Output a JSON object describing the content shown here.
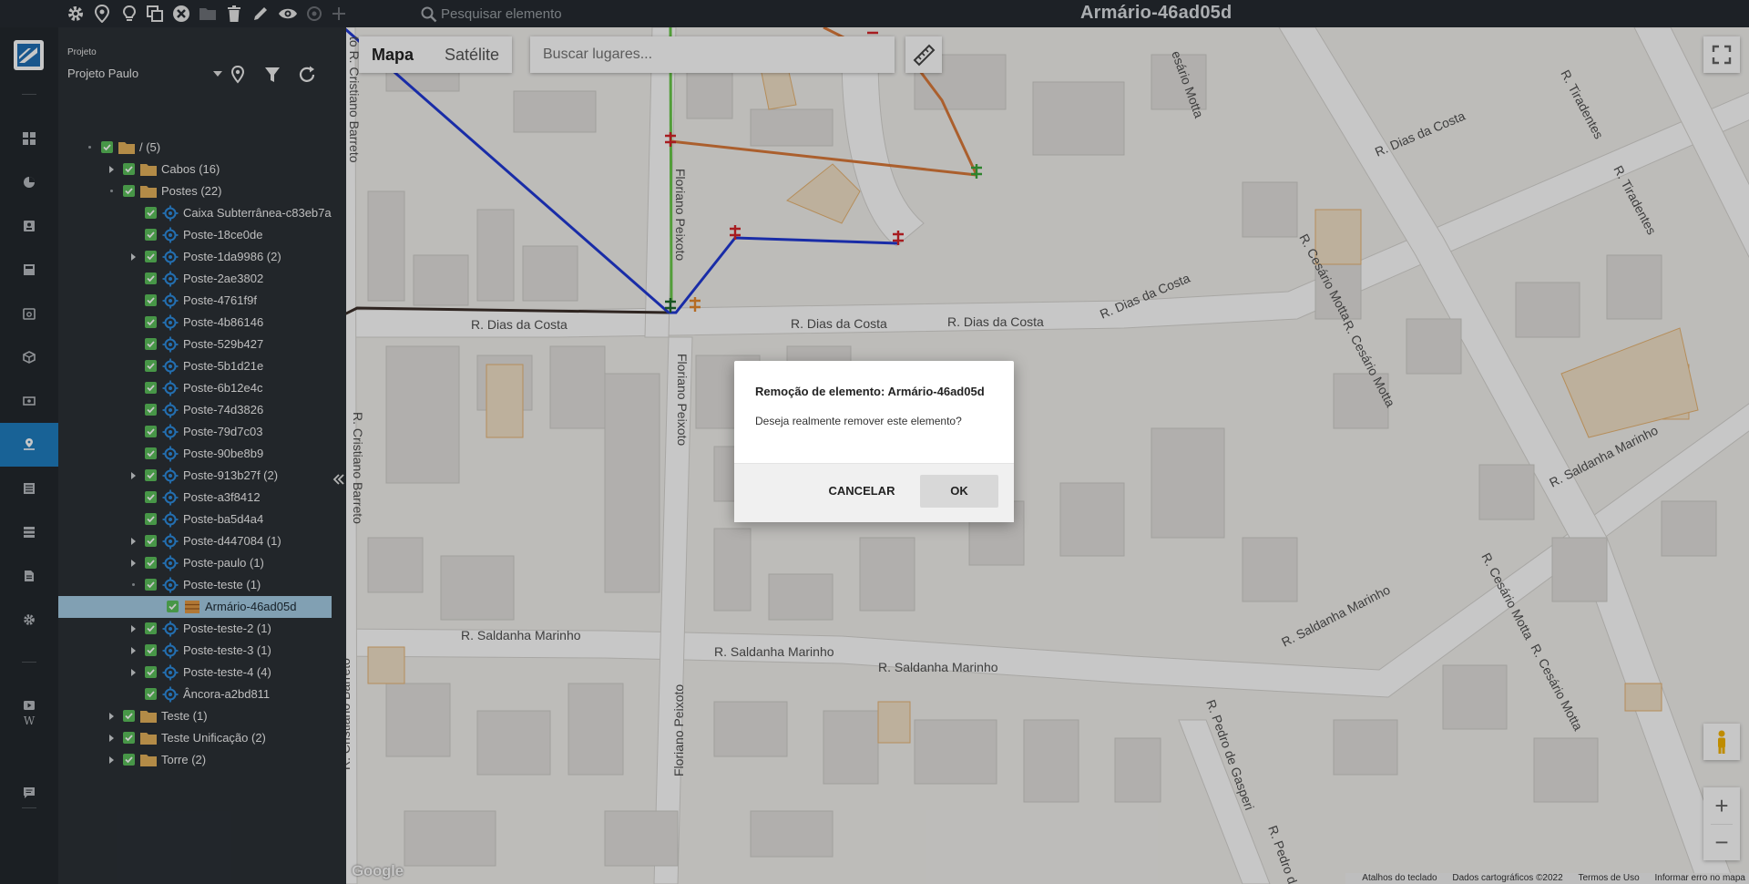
{
  "topbar": {
    "search_placeholder": "Pesquisar elemento",
    "element_title": "Armário-46ad05d",
    "icons": [
      "gear-icon",
      "map-pin-icon",
      "lightbulb-icon",
      "copy-icon",
      "close-circle-icon",
      "folder-icon",
      "trash-icon",
      "pencil-icon",
      "eye-icon",
      "location-off-icon",
      "plus-icon"
    ]
  },
  "panel": {
    "project_caption": "Projeto",
    "project_value": "Projeto Paulo"
  },
  "tree": [
    {
      "label": "/ (5)",
      "depth": 0,
      "icon": "folder",
      "arrow": "dot"
    },
    {
      "label": "Cabos (16)",
      "depth": 1,
      "icon": "folder",
      "arrow": "right"
    },
    {
      "label": "Postes (22)",
      "depth": 1,
      "icon": "folder",
      "arrow": "dot"
    },
    {
      "label": "Caixa Subterrânea-c83eb7a",
      "depth": 2,
      "icon": "target",
      "arrow": "none"
    },
    {
      "label": "Poste-18ce0de",
      "depth": 2,
      "icon": "target",
      "arrow": "none"
    },
    {
      "label": "Poste-1da9986 (2)",
      "depth": 2,
      "icon": "target",
      "arrow": "right"
    },
    {
      "label": "Poste-2ae3802",
      "depth": 2,
      "icon": "target",
      "arrow": "none"
    },
    {
      "label": "Poste-4761f9f",
      "depth": 2,
      "icon": "target",
      "arrow": "none"
    },
    {
      "label": "Poste-4b86146",
      "depth": 2,
      "icon": "target",
      "arrow": "none"
    },
    {
      "label": "Poste-529b427",
      "depth": 2,
      "icon": "target",
      "arrow": "none"
    },
    {
      "label": "Poste-5b1d21e",
      "depth": 2,
      "icon": "target",
      "arrow": "none"
    },
    {
      "label": "Poste-6b12e4c",
      "depth": 2,
      "icon": "target",
      "arrow": "none"
    },
    {
      "label": "Poste-74d3826",
      "depth": 2,
      "icon": "target",
      "arrow": "none"
    },
    {
      "label": "Poste-79d7c03",
      "depth": 2,
      "icon": "target",
      "arrow": "none"
    },
    {
      "label": "Poste-90be8b9",
      "depth": 2,
      "icon": "target",
      "arrow": "none"
    },
    {
      "label": "Poste-913b27f (2)",
      "depth": 2,
      "icon": "target",
      "arrow": "right"
    },
    {
      "label": "Poste-a3f8412",
      "depth": 2,
      "icon": "target",
      "arrow": "none"
    },
    {
      "label": "Poste-ba5d4a4",
      "depth": 2,
      "icon": "target",
      "arrow": "none"
    },
    {
      "label": "Poste-d447084 (1)",
      "depth": 2,
      "icon": "target",
      "arrow": "right"
    },
    {
      "label": "Poste-paulo (1)",
      "depth": 2,
      "icon": "target",
      "arrow": "right"
    },
    {
      "label": "Poste-teste (1)",
      "depth": 2,
      "icon": "target",
      "arrow": "dot"
    },
    {
      "label": "Armário-46ad05d",
      "depth": 3,
      "icon": "cabinet",
      "arrow": "none",
      "selected": true
    },
    {
      "label": "Poste-teste-2 (1)",
      "depth": 2,
      "icon": "target",
      "arrow": "right"
    },
    {
      "label": "Poste-teste-3 (1)",
      "depth": 2,
      "icon": "target",
      "arrow": "right"
    },
    {
      "label": "Poste-teste-4 (4)",
      "depth": 2,
      "icon": "target",
      "arrow": "right"
    },
    {
      "label": "Âncora-a2bd811",
      "depth": 2,
      "icon": "target",
      "arrow": "none"
    },
    {
      "label": "Teste (1)",
      "depth": 1,
      "icon": "folder",
      "arrow": "right"
    },
    {
      "label": "Teste Unificação (2)",
      "depth": 1,
      "icon": "folder",
      "arrow": "right"
    },
    {
      "label": "Torre (2)",
      "depth": 1,
      "icon": "folder",
      "arrow": "right"
    }
  ],
  "map": {
    "map_type_active": "Mapa",
    "map_type_other": "Satélite",
    "places_placeholder": "Buscar lugares...",
    "google_logo": "Google",
    "attribution": {
      "shortcuts": "Atalhos do teclado",
      "data": "Dados cartográficos ©2022",
      "terms": "Termos de Uso",
      "report": "Informar erro no mapa"
    },
    "zoom_in": "+",
    "zoom_out": "−",
    "streets": {
      "dias_da_costa": "R. Dias da Costa",
      "floriano": "Floriano Peixoto",
      "cristiano": "R. Cristiano Barreto",
      "cristiano_top": "to R. Cristiano Barreto",
      "cesario": "R. Cesário Motta",
      "cesario_top": "esário Motta",
      "saldanha": "R. Saldanha Marinho",
      "tiradentes": "R. Tiradentes",
      "pedro": "R. Pedro de Gasperi",
      "pedro_short": "R. Pedro d"
    }
  },
  "modal": {
    "title": "Remoção de elemento: Armário-46ad05d",
    "message": "Deseja realmente remover este elemento?",
    "cancel_label": "CANCELAR",
    "ok_label": "OK"
  },
  "rail": {
    "wiki_letter": "W"
  },
  "colors": {
    "accent": "#1f7ec1",
    "selected_row": "#a6cde6",
    "check_green": "#5cc05c",
    "folder": "#e6b35c",
    "cable_blue": "#2139d6",
    "cable_orange": "#dc7a3a",
    "cable_green": "#6acb4a",
    "pole_red": "#d6252a"
  }
}
